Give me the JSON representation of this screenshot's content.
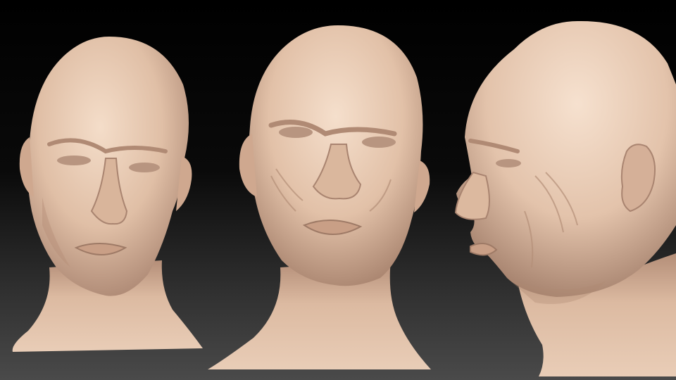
{
  "scene": {
    "background_top": "#000000",
    "background_bottom": "#4a4a4a",
    "skin_light": "#f2d9c4",
    "skin_mid": "#dcb9a0",
    "skin_shadow": "#a98470",
    "views": [
      {
        "name": "three-quarter-left",
        "icon": "sculpted-head-icon"
      },
      {
        "name": "front",
        "icon": "sculpted-head-icon"
      },
      {
        "name": "profile-left",
        "icon": "sculpted-head-icon"
      }
    ]
  }
}
